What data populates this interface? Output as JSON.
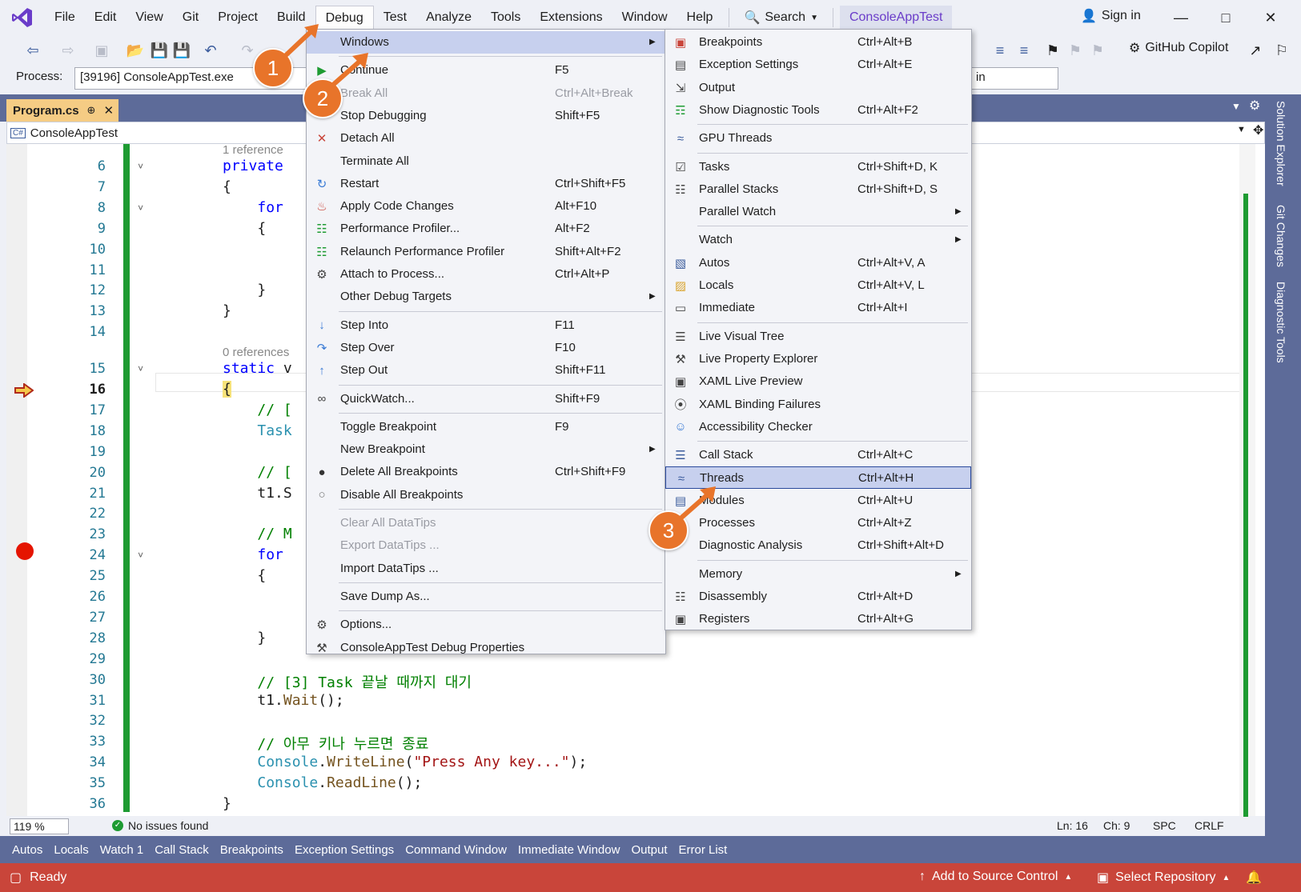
{
  "menubar": {
    "items": [
      "File",
      "Edit",
      "View",
      "Git",
      "Project",
      "Build",
      "Debug",
      "Test",
      "Analyze",
      "Tools",
      "Extensions",
      "Window",
      "Help"
    ],
    "search_label": "Search",
    "solution_name": "ConsoleAppTest",
    "signin_label": "Sign in"
  },
  "toolbar": {
    "process_label": "Process:",
    "process_value": "[39196] ConsoleAppTest.exe",
    "copilot_label": "GitHub Copilot",
    "right_combo_value": "in"
  },
  "document": {
    "tab_label": "Program.cs",
    "nav_combo_value": "ConsoleAppTest",
    "nav_badge": "C#"
  },
  "right_rail": {
    "labels": [
      "Solution Explorer",
      "Git Changes",
      "Diagnostic Tools"
    ]
  },
  "editor": {
    "lines": [
      {
        "ln": "",
        "ref": "1 reference"
      },
      {
        "ln": "6",
        "tokens": [
          [
            "kw",
            "private"
          ]
        ]
      },
      {
        "ln": "7",
        "tokens": [
          [
            "",
            "{"
          ]
        ]
      },
      {
        "ln": "8",
        "tokens": [
          [
            "",
            "    "
          ],
          [
            "kw",
            "for"
          ]
        ]
      },
      {
        "ln": "9",
        "tokens": [
          [
            "",
            "    {"
          ]
        ]
      },
      {
        "ln": "10",
        "tokens": []
      },
      {
        "ln": "11",
        "tokens": []
      },
      {
        "ln": "12",
        "tokens": [
          [
            "",
            "    }"
          ]
        ]
      },
      {
        "ln": "13",
        "tokens": [
          [
            "",
            "}"
          ]
        ]
      },
      {
        "ln": "14",
        "tokens": []
      },
      {
        "ln": "",
        "ref": "0 references"
      },
      {
        "ln": "15",
        "tokens": [
          [
            "kw",
            "static"
          ],
          [
            "",
            " v"
          ]
        ]
      },
      {
        "ln": "16",
        "tokens": [
          [
            "",
            "{"
          ]
        ]
      },
      {
        "ln": "17",
        "tokens": [
          [
            "",
            "    "
          ],
          [
            "cm",
            "// ["
          ]
        ]
      },
      {
        "ln": "18",
        "tokens": [
          [
            "",
            "    "
          ],
          [
            "ty",
            "Task"
          ]
        ]
      },
      {
        "ln": "19",
        "tokens": []
      },
      {
        "ln": "20",
        "tokens": [
          [
            "",
            "    "
          ],
          [
            "cm",
            "// ["
          ]
        ]
      },
      {
        "ln": "21",
        "tokens": [
          [
            "",
            "    t1.S"
          ]
        ]
      },
      {
        "ln": "22",
        "tokens": []
      },
      {
        "ln": "23",
        "tokens": [
          [
            "",
            "    "
          ],
          [
            "cm",
            "// M"
          ]
        ]
      },
      {
        "ln": "24",
        "tokens": [
          [
            "",
            "    "
          ],
          [
            "kw",
            "for"
          ]
        ]
      },
      {
        "ln": "25",
        "tokens": [
          [
            "",
            "    {"
          ]
        ]
      },
      {
        "ln": "26",
        "tokens": []
      },
      {
        "ln": "27",
        "tokens": []
      },
      {
        "ln": "28",
        "tokens": [
          [
            "",
            "    }"
          ]
        ]
      },
      {
        "ln": "29",
        "tokens": []
      },
      {
        "ln": "30",
        "tokens": [
          [
            "",
            "    "
          ],
          [
            "cm",
            "// [3] Task 끝날 때까지 대기"
          ]
        ]
      },
      {
        "ln": "31",
        "tokens": [
          [
            "",
            "    t1."
          ],
          [
            "fn",
            "Wait"
          ],
          [
            "",
            "();"
          ]
        ]
      },
      {
        "ln": "32",
        "tokens": []
      },
      {
        "ln": "33",
        "tokens": [
          [
            "",
            "    "
          ],
          [
            "cm",
            "// 아무 키나 누르면 종료"
          ]
        ]
      },
      {
        "ln": "34",
        "tokens": [
          [
            "",
            "    "
          ],
          [
            "ty",
            "Console"
          ],
          [
            "",
            "."
          ],
          [
            "fn",
            "WriteLine"
          ],
          [
            "",
            "("
          ],
          [
            "str",
            "\"Press Any key...\""
          ],
          [
            "",
            ");"
          ]
        ]
      },
      {
        "ln": "35",
        "tokens": [
          [
            "",
            "    "
          ],
          [
            "ty",
            "Console"
          ],
          [
            "",
            "."
          ],
          [
            "fn",
            "ReadLine"
          ],
          [
            "",
            "();"
          ]
        ]
      },
      {
        "ln": "36",
        "tokens": [
          [
            "",
            "}"
          ]
        ]
      }
    ]
  },
  "editor_status": {
    "zoom": "119 %",
    "issues": "No issues found",
    "line": "Ln: 16",
    "col": "Ch: 9",
    "spc": "SPC",
    "eol": "CRLF"
  },
  "tool_tabs": [
    "Autos",
    "Locals",
    "Watch 1",
    "Call Stack",
    "Breakpoints",
    "Exception Settings",
    "Command Window",
    "Immediate Window",
    "Output",
    "Error List"
  ],
  "statusbar": {
    "ready": "Ready",
    "source_control": "Add to Source Control",
    "repository": "Select Repository"
  },
  "debug_menu": {
    "items": [
      {
        "label": "Windows",
        "submenu": true,
        "icon": "none"
      },
      {
        "sep": true
      },
      {
        "label": "Continue",
        "shortcut": "F5",
        "icon": "play-icon"
      },
      {
        "label": "Break All",
        "shortcut": "Ctrl+Alt+Break",
        "disabled": true,
        "icon": "none"
      },
      {
        "label": "Stop Debugging",
        "shortcut": "Shift+F5",
        "icon": "none"
      },
      {
        "label": "Detach All",
        "icon": "close-icon"
      },
      {
        "label": "Terminate All",
        "icon": "none"
      },
      {
        "label": "Restart",
        "shortcut": "Ctrl+Shift+F5",
        "icon": "restart-icon"
      },
      {
        "label": "Apply Code Changes",
        "shortcut": "Alt+F10",
        "icon": "flame-icon"
      },
      {
        "label": "Performance Profiler...",
        "shortcut": "Alt+F2",
        "icon": "chart-icon"
      },
      {
        "label": "Relaunch Performance Profiler",
        "shortcut": "Shift+Alt+F2",
        "icon": "chart-icon"
      },
      {
        "label": "Attach to Process...",
        "shortcut": "Ctrl+Alt+P",
        "icon": "gears-icon"
      },
      {
        "label": "Other Debug Targets",
        "submenu": true,
        "icon": "none"
      },
      {
        "sep": true
      },
      {
        "label": "Step Into",
        "shortcut": "F11",
        "icon": "step-into-icon"
      },
      {
        "label": "Step Over",
        "shortcut": "F10",
        "icon": "step-over-icon"
      },
      {
        "label": "Step Out",
        "shortcut": "Shift+F11",
        "icon": "step-out-icon"
      },
      {
        "sep": true
      },
      {
        "label": "QuickWatch...",
        "shortcut": "Shift+F9",
        "icon": "glasses-icon"
      },
      {
        "sep": true
      },
      {
        "label": "Toggle Breakpoint",
        "shortcut": "F9",
        "icon": "none"
      },
      {
        "label": "New Breakpoint",
        "submenu": true,
        "icon": "none"
      },
      {
        "label": "Delete All Breakpoints",
        "shortcut": "Ctrl+Shift+F9",
        "icon": "delete-breakpoints-icon"
      },
      {
        "label": "Disable All Breakpoints",
        "icon": "disable-breakpoints-icon"
      },
      {
        "sep": true
      },
      {
        "label": "Clear All DataTips",
        "disabled": true,
        "icon": "none"
      },
      {
        "label": "Export DataTips ...",
        "disabled": true,
        "icon": "none"
      },
      {
        "label": "Import DataTips ...",
        "icon": "none"
      },
      {
        "sep": true
      },
      {
        "label": "Save Dump As...",
        "icon": "none"
      },
      {
        "sep": true
      },
      {
        "label": "Options...",
        "icon": "gear-icon"
      },
      {
        "label": "ConsoleAppTest Debug Properties",
        "icon": "wrench-icon"
      }
    ]
  },
  "windows_menu": {
    "items": [
      {
        "label": "Breakpoints",
        "shortcut": "Ctrl+Alt+B",
        "icon": "breakpoints-window-icon"
      },
      {
        "label": "Exception Settings",
        "shortcut": "Ctrl+Alt+E",
        "icon": "exception-icon"
      },
      {
        "label": "Output",
        "icon": "output-icon"
      },
      {
        "label": "Show Diagnostic Tools",
        "shortcut": "Ctrl+Alt+F2",
        "icon": "diagnostic-icon"
      },
      {
        "sep": true
      },
      {
        "label": "GPU Threads",
        "icon": "gpu-threads-icon"
      },
      {
        "sep": true
      },
      {
        "label": "Tasks",
        "shortcut": "Ctrl+Shift+D, K",
        "icon": "tasks-icon"
      },
      {
        "label": "Parallel Stacks",
        "shortcut": "Ctrl+Shift+D, S",
        "icon": "parallel-stacks-icon"
      },
      {
        "label": "Parallel Watch",
        "submenu": true,
        "icon": "none"
      },
      {
        "sep": true
      },
      {
        "label": "Watch",
        "submenu": true,
        "icon": "none"
      },
      {
        "label": "Autos",
        "shortcut": "Ctrl+Alt+V, A",
        "icon": "autos-icon"
      },
      {
        "label": "Locals",
        "shortcut": "Ctrl+Alt+V, L",
        "icon": "locals-icon"
      },
      {
        "label": "Immediate",
        "shortcut": "Ctrl+Alt+I",
        "icon": "immediate-icon"
      },
      {
        "sep": true
      },
      {
        "label": "Live Visual Tree",
        "icon": "tree-icon"
      },
      {
        "label": "Live Property Explorer",
        "icon": "wrench-icon"
      },
      {
        "label": "XAML Live Preview",
        "icon": "camera-icon"
      },
      {
        "label": "XAML Binding Failures",
        "icon": "binding-icon"
      },
      {
        "label": "Accessibility Checker",
        "icon": "accessibility-icon"
      },
      {
        "sep": true
      },
      {
        "label": "Call Stack",
        "shortcut": "Ctrl+Alt+C",
        "icon": "call-stack-icon"
      },
      {
        "label": "Threads",
        "shortcut": "Ctrl+Alt+H",
        "icon": "threads-icon",
        "highlight": true
      },
      {
        "label": "Modules",
        "shortcut": "Ctrl+Alt+U",
        "icon": "modules-icon"
      },
      {
        "label": "Processes",
        "shortcut": "Ctrl+Alt+Z",
        "icon": "none"
      },
      {
        "label": "Diagnostic Analysis",
        "shortcut": "Ctrl+Shift+Alt+D",
        "icon": "none"
      },
      {
        "sep": true
      },
      {
        "label": "Memory",
        "submenu": true,
        "icon": "none"
      },
      {
        "label": "Disassembly",
        "shortcut": "Ctrl+Alt+D",
        "icon": "disassembly-icon"
      },
      {
        "label": "Registers",
        "shortcut": "Ctrl+Alt+G",
        "icon": "registers-icon"
      }
    ]
  },
  "callouts": [
    "1",
    "2",
    "3"
  ],
  "colors": {
    "accent": "#6a3cc9",
    "statusbar": "#c9453a",
    "callout": "#e8742a",
    "tool_strip": "#5d6b99"
  }
}
